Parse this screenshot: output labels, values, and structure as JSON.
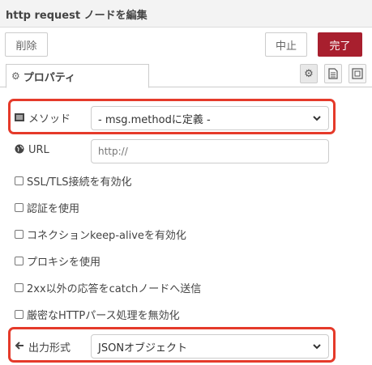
{
  "header": {
    "title": "http request ノードを編集"
  },
  "toolbar": {
    "delete_label": "削除",
    "cancel_label": "中止",
    "done_label": "完了"
  },
  "tabs": [
    {
      "label": "プロパティ",
      "icon": "gear-icon"
    }
  ],
  "tab_icons": [
    "settings-icon",
    "document-icon",
    "frame-icon"
  ],
  "method": {
    "label": "メソッド",
    "icon": "list-icon",
    "value": "- msg.methodに定義 -"
  },
  "url": {
    "label": "URL",
    "icon": "globe-icon",
    "placeholder": "http://"
  },
  "checkboxes": [
    {
      "label": "SSL/TLS接続を有効化",
      "checked": false
    },
    {
      "label": "認証を使用",
      "checked": false
    },
    {
      "label": "コネクションkeep-aliveを有効化",
      "checked": false
    },
    {
      "label": "プロキシを使用",
      "checked": false
    },
    {
      "label": "2xx以外の応答をcatchノードへ送信",
      "checked": false
    },
    {
      "label": "厳密なHTTPパース処理を無効化",
      "checked": false
    }
  ],
  "output": {
    "label": "出力形式",
    "icon": "arrow-left-icon",
    "value": "JSONオブジェクト"
  },
  "colors": {
    "accent": "#a81f2e",
    "highlight": "#e53a2a"
  }
}
